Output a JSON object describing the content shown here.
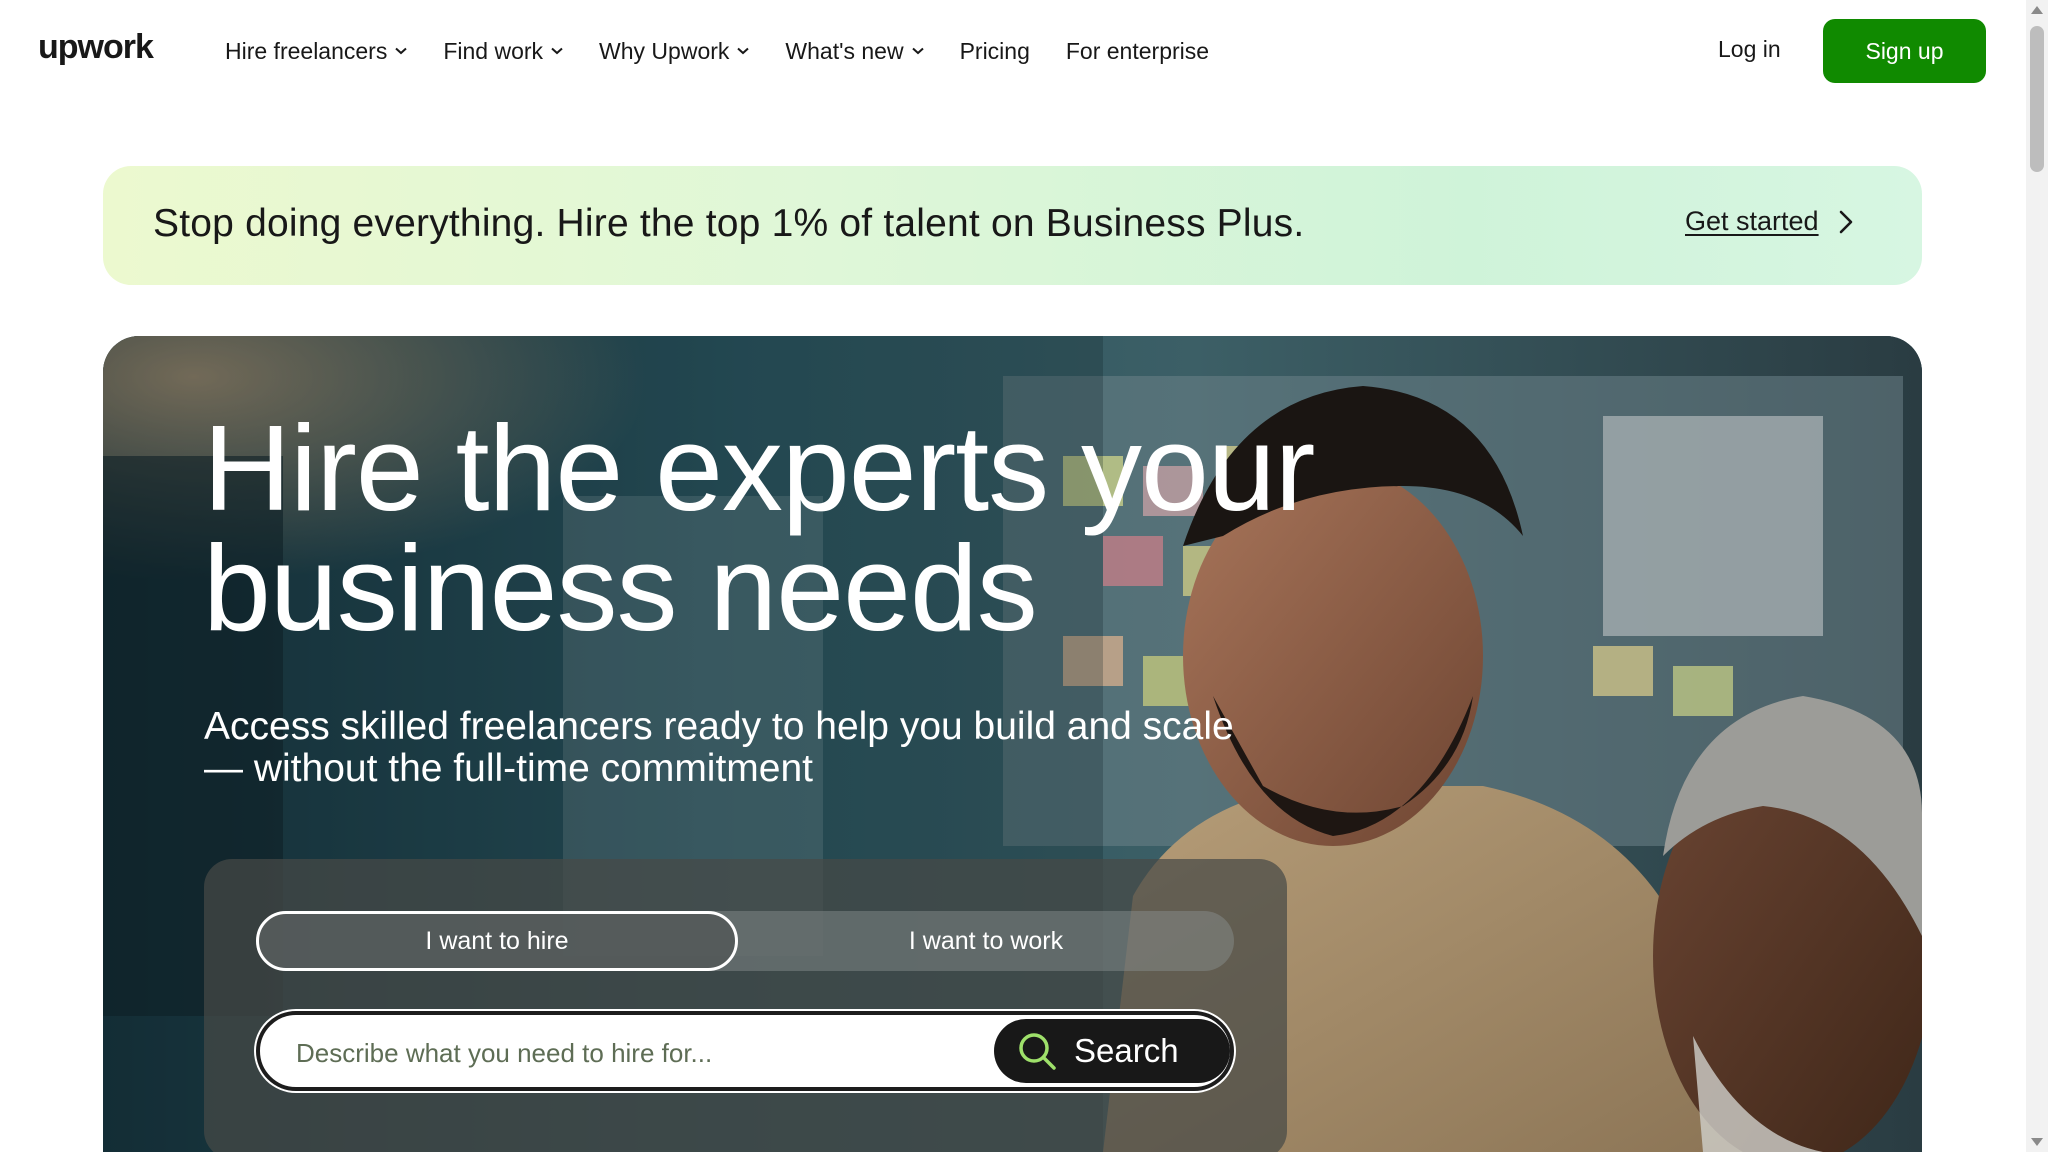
{
  "brand": {
    "name": "upwork",
    "accent_color": "#108a00"
  },
  "nav": {
    "items": [
      {
        "label": "Hire freelancers",
        "has_dropdown": true
      },
      {
        "label": "Find work",
        "has_dropdown": true
      },
      {
        "label": "Why Upwork",
        "has_dropdown": true
      },
      {
        "label": "What's new",
        "has_dropdown": true
      },
      {
        "label": "Pricing",
        "has_dropdown": false
      },
      {
        "label": "For enterprise",
        "has_dropdown": false
      }
    ],
    "login_label": "Log in",
    "signup_label": "Sign up"
  },
  "promo": {
    "text": "Stop doing everything. Hire the top 1% of talent on Business Plus.",
    "link_label": "Get started"
  },
  "hero": {
    "title_line1": "Hire the experts your",
    "title_line2": "business needs",
    "subtitle": "Access skilled freelancers ready to help you build and scale — without the full-time commitment",
    "toggle": {
      "hire_label": "I want to hire",
      "work_label": "I want to work",
      "selected": "hire"
    },
    "search": {
      "placeholder": "Describe what you need to hire for...",
      "value": "",
      "button_label": "Search"
    }
  }
}
